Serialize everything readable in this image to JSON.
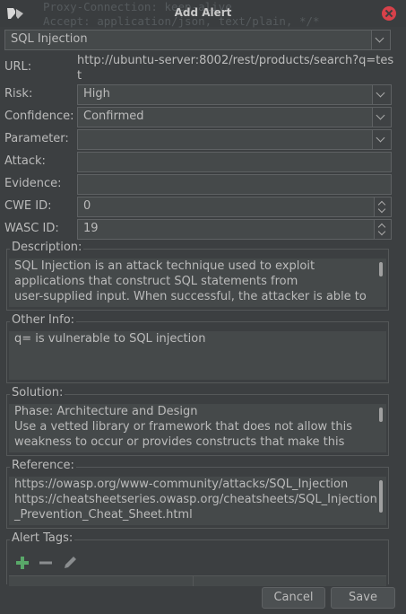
{
  "window": {
    "title": "Add Alert",
    "background_lines": [
      "Proxy-Connection: keep-alive",
      "Accept: application/json, text/plain, */*"
    ]
  },
  "alert": {
    "name": "SQL Injection",
    "url_label": "URL:",
    "url_value_line1": "http://ubuntu-server:8002/rest/products/search?q=tes",
    "url_value_line2": "t",
    "risk_label": "Risk:",
    "risk_value": "High",
    "confidence_label": "Confidence:",
    "confidence_value": "Confirmed",
    "parameter_label": "Parameter:",
    "parameter_value": "",
    "attack_label": "Attack:",
    "attack_value": "",
    "evidence_label": "Evidence:",
    "evidence_value": "",
    "cwe_label": "CWE ID:",
    "cwe_value": "0",
    "wasc_label": "WASC ID:",
    "wasc_value": "19"
  },
  "description": {
    "label": "Description:",
    "lines": [
      "SQL Injection is an attack technique used to exploit",
      "applications that construct SQL statements from",
      "user-supplied input. When successful, the attacker is able to"
    ]
  },
  "other_info": {
    "label": "Other Info:",
    "lines": [
      "q= is vulnerable to SQL injection"
    ]
  },
  "solution": {
    "label": "Solution:",
    "lines": [
      "Phase: Architecture and Design",
      "Use a vetted library or framework that does not allow this",
      "weakness to occur or provides constructs that make this"
    ]
  },
  "reference": {
    "label": "Reference:",
    "lines": [
      "https://owasp.org/www-community/attacks/SQL_Injection",
      "https://cheatsheetseries.owasp.org/cheatsheets/SQL_Injection",
      "_Prevention_Cheat_Sheet.html"
    ]
  },
  "alert_tags": {
    "label": "Alert Tags:"
  },
  "buttons": {
    "cancel": "Cancel",
    "save": "Save"
  },
  "colors": {
    "add": "#59a869",
    "close": "#d7414a",
    "background": "#3c3f41"
  },
  "icons": [
    "window-icon",
    "close-icon",
    "add-icon",
    "remove-icon",
    "edit-icon",
    "chevron-down-icon"
  ]
}
